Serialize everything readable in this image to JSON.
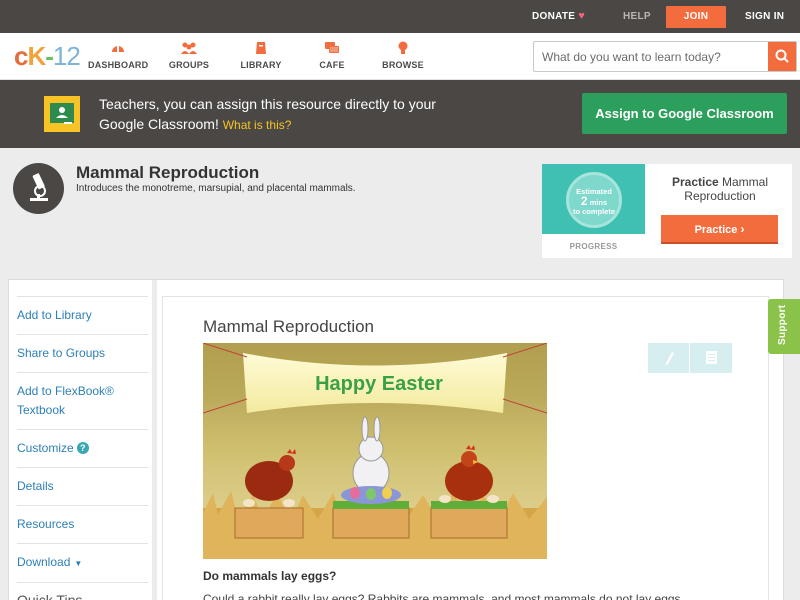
{
  "topbar": {
    "donate": "DONATE",
    "help": "HELP",
    "join": "JOIN",
    "signin": "SIGN IN"
  },
  "nav": {
    "logo": {
      "c": "c",
      "k": "K",
      "dash": "-",
      "n": "12"
    },
    "items": [
      {
        "label": "DASHBOARD",
        "icon": "dashboard-icon"
      },
      {
        "label": "GROUPS",
        "icon": "groups-icon"
      },
      {
        "label": "LIBRARY",
        "icon": "library-icon"
      },
      {
        "label": "CAFE",
        "icon": "cafe-icon"
      },
      {
        "label": "BROWSE",
        "icon": "browse-icon"
      }
    ],
    "search_placeholder": "What do you want to learn today?"
  },
  "banner": {
    "text": "Teachers, you can assign this resource directly to your Google Classroom!",
    "what": "What is this?",
    "button": "Assign to Google Classroom"
  },
  "header": {
    "title": "Mammal Reproduction",
    "subtitle": "Introduces the monotreme, marsupial, and placental mammals.",
    "practice": {
      "estimate_line1": "Estimated",
      "estimate_big": "2",
      "estimate_unit": "mins",
      "estimate_line2": "to complete",
      "progress": "PROGRESS",
      "title_bold": "Practice",
      "title_rest": "Mammal Reproduction",
      "button": "Practice"
    }
  },
  "sidebar": {
    "items": [
      {
        "label": "Add to Library"
      },
      {
        "label": "Share to Groups"
      },
      {
        "label": "Add to FlexBook® Textbook"
      },
      {
        "label": "Customize"
      },
      {
        "label": "Details"
      },
      {
        "label": "Resources"
      },
      {
        "label": "Download"
      }
    ],
    "quick_tips": "Quick Tips"
  },
  "article": {
    "title": "Mammal Reproduction",
    "image_caption_text": "Happy Easter",
    "caption": "Do mammals lay eggs?",
    "body": "Could a rabbit really lay eggs? Rabbits are mammals, and most mammals do not lay eggs."
  },
  "support": "Support",
  "colors": {
    "accent": "#f26c3e",
    "dark": "#4a4745",
    "green": "#2c9f5c",
    "link": "#2c7fb8"
  }
}
